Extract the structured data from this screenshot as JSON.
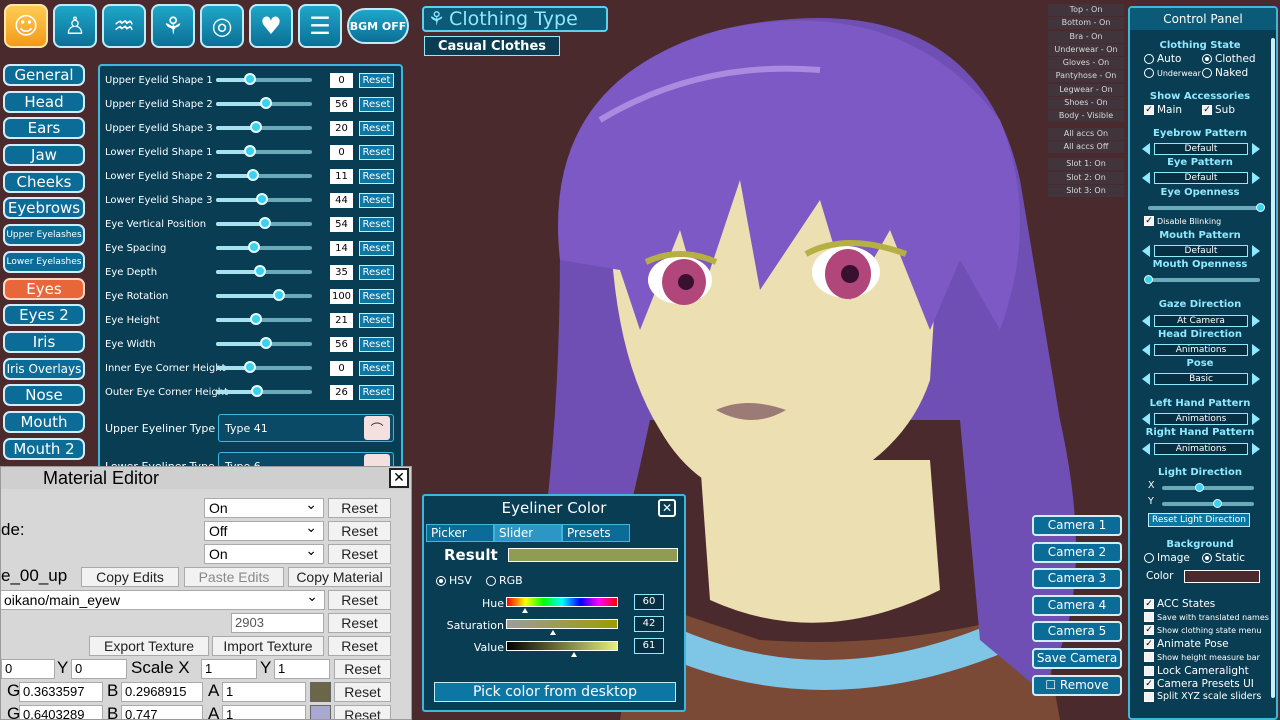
{
  "top_bar": {
    "icons": [
      "smiley-icon",
      "body-icon",
      "hair-icon",
      "clothing-icon",
      "ring-icon",
      "heart-icon",
      "menu-icon"
    ],
    "bgm_label": "BGM OFF"
  },
  "clothing_type": {
    "title": "Clothing Type",
    "value": "Casual Clothes"
  },
  "categories": [
    "General",
    "Head",
    "Ears",
    "Jaw",
    "Cheeks",
    "Eyebrows",
    "Upper Eyelashes",
    "Lower Eyelashes",
    "Eyes",
    "Eyes 2",
    "Iris",
    "Iris Overlays",
    "Nose",
    "Mouth",
    "Mouth 2"
  ],
  "active_category": "Eyes",
  "sliders": [
    {
      "label": "Upper Eyelid Shape 1",
      "value": "0",
      "pos": 0.35
    },
    {
      "label": "Upper Eyelid Shape 2",
      "value": "56",
      "pos": 0.52
    },
    {
      "label": "Upper Eyelid Shape 3",
      "value": "20",
      "pos": 0.42
    },
    {
      "label": "Lower Eyelid Shape 1",
      "value": "0",
      "pos": 0.35
    },
    {
      "label": "Lower Eyelid Shape 2",
      "value": "11",
      "pos": 0.39
    },
    {
      "label": "Lower Eyelid Shape 3",
      "value": "44",
      "pos": 0.48
    },
    {
      "label": "Eye Vertical Position",
      "value": "54",
      "pos": 0.51
    },
    {
      "label": "Eye Spacing",
      "value": "14",
      "pos": 0.4
    },
    {
      "label": "Eye Depth",
      "value": "35",
      "pos": 0.46
    },
    {
      "label": "Eye Rotation",
      "value": "100",
      "pos": 0.66
    },
    {
      "label": "Eye Height",
      "value": "21",
      "pos": 0.42
    },
    {
      "label": "Eye Width",
      "value": "56",
      "pos": 0.52
    },
    {
      "label": "Inner Eye Corner Height",
      "value": "0",
      "pos": 0.35
    },
    {
      "label": "Outer Eye Corner Height",
      "value": "26",
      "pos": 0.43
    }
  ],
  "reset_label": "Reset",
  "eyeliner": {
    "upper_label": "Upper Eyeliner Type",
    "upper_value": "Type 41",
    "lower_label": "Lower Eyeliner Type",
    "lower_value": "Type 6"
  },
  "material_editor": {
    "title": "Material Editor",
    "close": "✕",
    "dropdown_1": "On",
    "dropdown_2": "Off",
    "dropdown_3": "On",
    "partial_label_2": "de:",
    "partial_label_4": "e_00_up",
    "copy_edits": "Copy Edits",
    "paste_edits": "Paste Edits",
    "copy_material": "Copy Material",
    "shader_value": "oikano/main_eyew",
    "render_queue": "2903",
    "export_texture": "Export Texture",
    "import_texture": "Import Texture",
    "offset_x": "0",
    "y_label": "Y",
    "offset_y": "0",
    "scale_label": "Scale X",
    "scale_x": "1",
    "scale_y": "1",
    "g_label": "G",
    "color1_g": "0.3633597",
    "b_label": "B",
    "color1_b": "0.2968915",
    "a_label": "A",
    "color1_a": "1",
    "color1_swatch": "#6b6648",
    "color2_g": "0.6403289",
    "color2_b": "0.747",
    "color2_a": "1",
    "color2_swatch": "#a8a8d0",
    "reset": "Reset"
  },
  "eyeliner_color": {
    "title": "Eyeliner Color",
    "close": "✕",
    "tabs": [
      "Picker",
      "Slider",
      "Presets"
    ],
    "active_tab": "Slider",
    "result_label": "Result",
    "result_color": "#8f9c52",
    "mode_hsv": "HSV",
    "mode_rgb": "RGB",
    "hue_label": "Hue",
    "hue_value": "60",
    "saturation_label": "Saturation",
    "saturation_value": "42",
    "value_label": "Value",
    "value_value": "61",
    "pick_label": "Pick color from desktop"
  },
  "clothing_states": [
    "Top - On",
    "Bottom - On",
    "Bra - On",
    "Underwear - On",
    "Gloves - On",
    "Pantyhose - On",
    "Legwear - On",
    "Shoes - On",
    "Body - Visible"
  ],
  "accs_states": [
    "All accs On",
    "All accs Off"
  ],
  "slots": [
    "Slot 1: On",
    "Slot 2: On",
    "Slot 3: On"
  ],
  "cameras": [
    "Camera 1",
    "Camera 2",
    "Camera 3",
    "Camera 4",
    "Camera 5",
    "Save Camera",
    "☐ Remove"
  ],
  "control_panel": {
    "title": "Control Panel",
    "clothing_state_head": "Clothing State",
    "auto": "Auto",
    "clothed": "Clothed",
    "underwear": "Underwear",
    "naked": "Naked",
    "show_accessories_head": "Show Accessories",
    "main": "Main",
    "sub": "Sub",
    "eyebrow_pattern_head": "Eyebrow Pattern",
    "eyebrow_pattern": "Default",
    "eye_pattern_head": "Eye Pattern",
    "eye_pattern": "Default",
    "eye_openness_head": "Eye Openness",
    "eye_openness": 1.0,
    "disable_blinking": "Disable Blinking",
    "mouth_pattern_head": "Mouth Pattern",
    "mouth_pattern": "Default",
    "mouth_openness_head": "Mouth Openness",
    "mouth_openness": 0.0,
    "gaze_direction_head": "Gaze Direction",
    "gaze_direction": "At Camera",
    "head_direction_head": "Head Direction",
    "head_direction": "Animations",
    "pose_head": "Pose",
    "pose": "Basic",
    "left_hand_head": "Left Hand Pattern",
    "left_hand": "Animations",
    "right_hand_head": "Right Hand Pattern",
    "right_hand": "Animations",
    "light_direction_head": "Light Direction",
    "x_label": "X",
    "y_label": "Y",
    "light_x": 0.4,
    "light_y": 0.6,
    "reset_light": "Reset Light Direction",
    "background_head": "Background",
    "image": "Image",
    "static": "Static",
    "color_label": "Color",
    "bg_color": "#4a2a2c",
    "acc_states": "ACC States",
    "save_translated": "Save with translated names",
    "show_clothing_menu": "Show clothing state menu",
    "animate_pose": "Animate Pose",
    "show_height_bar": "Show height measure bar",
    "lock_cameralight": "Lock Cameralight",
    "camera_presets_ui": "Camera Presets UI",
    "split_xyz": "Split XYZ scale sliders"
  }
}
